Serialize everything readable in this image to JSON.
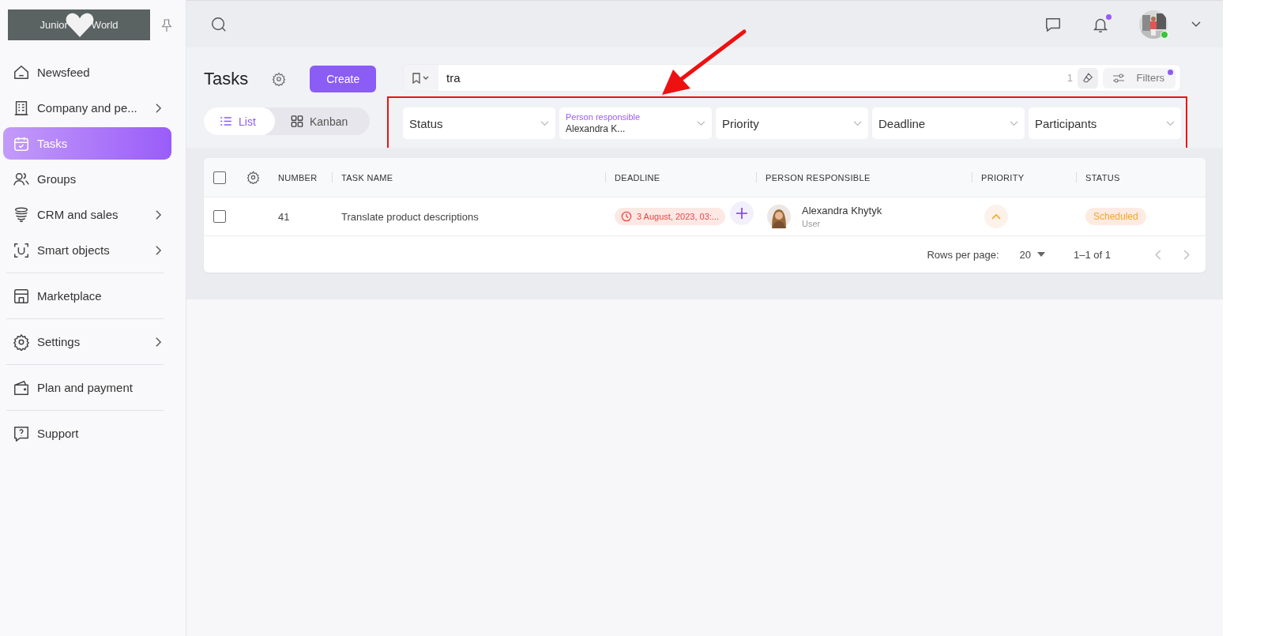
{
  "sidebar": {
    "logo": {
      "left": "Junior",
      "right": "World"
    },
    "sections": [
      {
        "items": [
          {
            "label": "Newsfeed",
            "selected": false,
            "has_submenu": false
          },
          {
            "label": "Company and pe...",
            "selected": false,
            "has_submenu": true
          },
          {
            "label": "Tasks",
            "selected": true,
            "has_submenu": false
          },
          {
            "label": "Groups",
            "selected": false,
            "has_submenu": false
          },
          {
            "label": "CRM and sales",
            "selected": false,
            "has_submenu": true
          },
          {
            "label": "Smart objects",
            "selected": false,
            "has_submenu": true
          }
        ]
      },
      {
        "items": [
          {
            "label": "Marketplace",
            "selected": false,
            "has_submenu": false
          }
        ]
      },
      {
        "items": [
          {
            "label": "Settings",
            "selected": false,
            "has_submenu": true
          }
        ]
      },
      {
        "items": [
          {
            "label": "Plan and payment",
            "selected": false,
            "has_submenu": false
          }
        ]
      },
      {
        "items": [
          {
            "label": "Support",
            "selected": false,
            "has_submenu": false
          }
        ]
      }
    ]
  },
  "topbar": {
    "notifications_unread": true,
    "user_online": true
  },
  "header": {
    "title": "Tasks",
    "create_button": "Create",
    "view_tabs": [
      {
        "label": "List",
        "selected": true
      },
      {
        "label": "Kanban",
        "selected": false
      }
    ]
  },
  "search": {
    "value": "tra",
    "count": "1",
    "filters_button": "Filters",
    "filters_active": true
  },
  "filters": [
    {
      "label": "Status"
    },
    {
      "label": "Person responsible",
      "value": "Alexandra K..."
    },
    {
      "label": "Priority"
    },
    {
      "label": "Deadline"
    },
    {
      "label": "Participants"
    }
  ],
  "table": {
    "all_checked": false,
    "columns": [
      "NUMBER",
      "TASK NAME",
      "DEADLINE",
      "PERSON RESPONSIBLE",
      "PRIORITY",
      "STATUS"
    ],
    "rows": [
      {
        "checked": false,
        "number": "41",
        "task_name": "Translate product descriptions",
        "deadline": "3 August, 2023, 03:...",
        "overdue": true,
        "person_name": "Alexandra Khytyk",
        "person_role": "User",
        "priority": {
          "kind": "up"
        },
        "status": "Scheduled"
      }
    ]
  },
  "pagination": {
    "rows_per_page_label": "Rows per page:",
    "rows_per_page": "20",
    "range": "1–1 of 1"
  }
}
